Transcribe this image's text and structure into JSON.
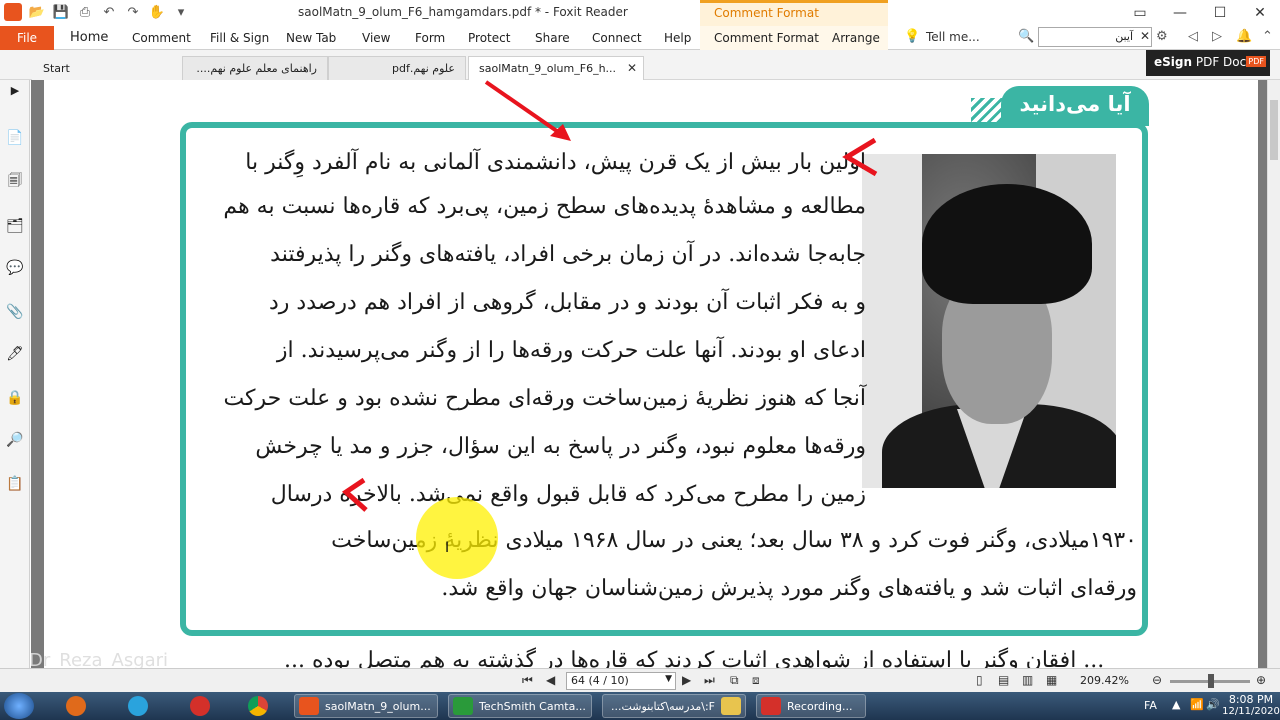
{
  "window": {
    "title": "saolMatn_9_olum_F6_hamgamdars.pdf * - Foxit Reader",
    "context_tab_title": "Comment Format"
  },
  "ribbon": {
    "file": "File",
    "tabs": [
      "Home",
      "Comment",
      "Fill & Sign",
      "New Tab",
      "View",
      "Form",
      "Protect",
      "Share",
      "Connect",
      "Help",
      "Comment Format",
      "Arrange"
    ],
    "tell_me": "Tell me...",
    "search_value": "آیبن"
  },
  "doc_tabs": [
    {
      "label": "Start"
    },
    {
      "label": "راهنمای معلم علوم نهم...."
    },
    {
      "label": "علوم نهم.pdf"
    },
    {
      "label": "saolMatn_9_olum_F6_h..."
    }
  ],
  "esign": {
    "prefix": "eSign",
    "label": "PDF Docs",
    "badge": "PDF"
  },
  "document": {
    "box_heading": "آیا می‌دانید",
    "lines": [
      "اولین بار بیش از یک قرن پیش، دانشمندی آلمانی به نام آلفرد وِگنر با",
      "مطالعه و مشاهدهٔ پدیده‌های سطح زمین، پی‌برد که  قاره‌ها نسبت به هم",
      "جابه‌جا شده‌اند.  در آن زمان برخی افراد، یافته‌های وگنر را پذیرفتند",
      "و به فکر اثبات آن بودند و در مقابل، گروهی از افراد هم درصدد رد",
      "ادعای او بودند. آنها علت حرکت ورقه‌ها را از وگنر می‌پرسیدند. از",
      "آنجا که هنوز نظریهٔ زمین‌ساخت ورقه‌ای مطرح نشده بود و علت حرکت",
      "ورقه‌ها معلوم نبود، وگنر در پاسخ به این سؤال، جزر و مد یا چرخش",
      "زمین را مطرح می‌کرد که قابل قبول واقع نمی‌شد. بالاخره درسال",
      "۱۹۳۰میلادی، وگنر فوت کرد و ۳۸ سال بعد؛ یعنی در سال ۱۹۶۸ میلادی نظریهٔ زمین‌ساخت",
      "ورقه‌ای اثبات شد و یافته‌های وگنر مورد پذیرش زمین‌شناسان جهان واقع شد."
    ],
    "bottom_cut": "... افقان وگنر با استفاده از شواهدی اثبات کردند که قاره‌ها در گذشته به هم متصل بوده ..."
  },
  "watermark": "@Dr_Reza_Asgari",
  "status": {
    "page_field": "64 (4 / 10)",
    "zoom": "209.42%"
  },
  "taskbar": {
    "tasks": [
      "saolMatn_9_olum...",
      "TechSmith Camta...",
      "F:\\مدرسه\\کتابنوشت...",
      "Recording..."
    ],
    "lang": "FA",
    "time": "8:08 PM",
    "date": "12/11/2020"
  },
  "colors": {
    "accent": "#e8541e",
    "box": "#3bb5a4",
    "annotation": "#e8141e"
  }
}
